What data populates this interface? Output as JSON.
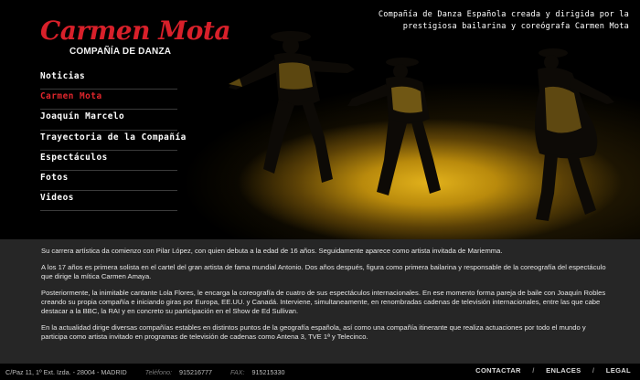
{
  "brand": {
    "logo_name": "Carmen Mota",
    "logo_subtitle": "COMPAÑÍA DE DANZA"
  },
  "tagline": {
    "line1": "Compañía de Danza Española creada y dirigida por la",
    "line2": "prestigiosa bailarina y coreógrafa Carmen Mota"
  },
  "nav": {
    "items": [
      {
        "label": "Noticias"
      },
      {
        "label": "Carmen Mota"
      },
      {
        "label": "Joaquín Marcelo"
      },
      {
        "label": "Trayectoria de la Compañía"
      },
      {
        "label": "Espectáculos"
      },
      {
        "label": "Fotos"
      },
      {
        "label": "Videos"
      }
    ],
    "active_color": "#e0262c"
  },
  "bio": {
    "paragraphs": [
      "Su carrera artística da comienzo con Pilar López, con quien debuta a la edad de 16 años. Seguidamente aparece como artista invitada de Mariemma.",
      "A los 17 años es primera solista en el cartel del gran artista de fama mundial Antonio. Dos años después, figura como primera bailarina y responsable de la coreografía del espectáculo que dirige la mítica Carmen Amaya.",
      "Posteriormente, la inimitable cantante Lola Flores, le encarga la coreografía de cuatro de sus espectáculos internacionales. En ese momento forma pareja de baile con Joaquín Robles creando su propia compañía e iniciando giras por Europa, EE.UU. y Canadá. Interviene, simultaneamente, en renombradas cadenas de televisión internacionales, entre las que cabe destacar a la BBC, la RAI y en concreto su participación en el Show de Ed Sullivan.",
      "En la actualidad dirige diversas compañías estables en distintos puntos de la geografía española, así  como una compañía itinerante que realiza actuaciones por todo el mundo y participa como artista invitado en programas de televisión de cadenas como Antena 3, TVE 1ª y Telecinco."
    ]
  },
  "footer": {
    "address": "C/Paz 11, 1º Ext. Izda. - 28004 - MADRID",
    "phone_label": "Teléfono:",
    "phone": "915216777",
    "fax_label": "FAX:",
    "fax": "915215330",
    "links": {
      "contact": "CONTACTAR",
      "links": "ENLACES",
      "legal": "LEGAL"
    },
    "separator": "/"
  },
  "colors": {
    "brand_red": "#d8202a",
    "panel_bg": "#262626"
  }
}
